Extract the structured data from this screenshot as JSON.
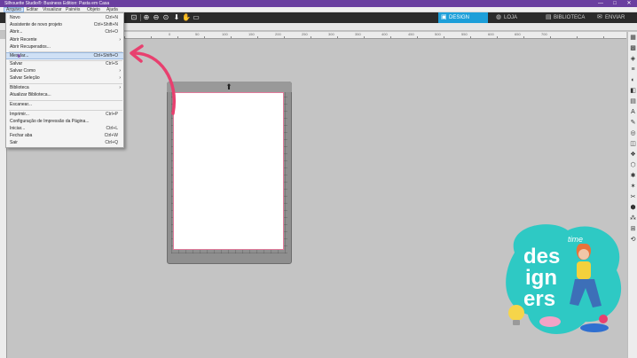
{
  "window": {
    "title": "Silhouette Studio®: Business Edition: Pasta em Casa",
    "controls": [
      "—",
      "□",
      "✕"
    ]
  },
  "menubar": {
    "items": [
      "Arquivo",
      "Editar",
      "Visualizar",
      "Painéis",
      "Objeto",
      "Ajuda"
    ]
  },
  "toolbar": {
    "tabs": [
      {
        "label": "DESIGN",
        "icon": "▣"
      },
      {
        "label": "LOJA",
        "icon": "◍"
      },
      {
        "label": "BIBLIOTECA",
        "icon": "▤"
      },
      {
        "label": "ENVIAR",
        "icon": "✉"
      }
    ]
  },
  "file_menu": {
    "items": [
      {
        "label": "Novo",
        "shortcut": "Ctrl+N"
      },
      {
        "label": "Assistente de novo projeto",
        "shortcut": "Ctrl+Shift+N"
      },
      {
        "label": "Abrir...",
        "shortcut": "Ctrl+O"
      },
      {
        "label": "Abrir Recente",
        "shortcut": "",
        "submenu": true
      },
      {
        "label": "Abrir Recuperados...",
        "shortcut": ""
      },
      {
        "label": "Mesclar...",
        "shortcut": "Ctrl+Shift+O",
        "highlight": true
      },
      {
        "label": "Salvar",
        "shortcut": "Ctrl+S"
      },
      {
        "label": "Salvar Como",
        "shortcut": "",
        "submenu": true
      },
      {
        "label": "Salvar Seleção",
        "shortcut": "",
        "submenu": true
      },
      {
        "label": "Biblioteca",
        "shortcut": "",
        "submenu": true
      },
      {
        "label": "Atualizar Biblioteca...",
        "shortcut": ""
      },
      {
        "label": "Escanear...",
        "shortcut": ""
      },
      {
        "label": "Imprimir...",
        "shortcut": "Ctrl+P"
      },
      {
        "label": "Configuração de Impressão da Página...",
        "shortcut": ""
      },
      {
        "label": "Iniciar...",
        "shortcut": "Ctrl+L"
      },
      {
        "label": "Fechar aba",
        "shortcut": "Ctrl+W"
      },
      {
        "label": "Sair",
        "shortcut": "Ctrl+Q"
      }
    ]
  },
  "ruler": {
    "ticks": [
      "0",
      "50",
      "100",
      "150",
      "200",
      "250",
      "300",
      "350",
      "400",
      "450",
      "500",
      "550",
      "600",
      "650",
      "700"
    ]
  },
  "logo": {
    "line1": "time",
    "line2": "des",
    "line3": "ign",
    "line4": "ers"
  },
  "colors": {
    "titlebar": "#6a3fa0",
    "accent_tab": "#1d9fd9",
    "annotation_arrow": "#e8406f",
    "logo_teal": "#2ec9c4"
  }
}
